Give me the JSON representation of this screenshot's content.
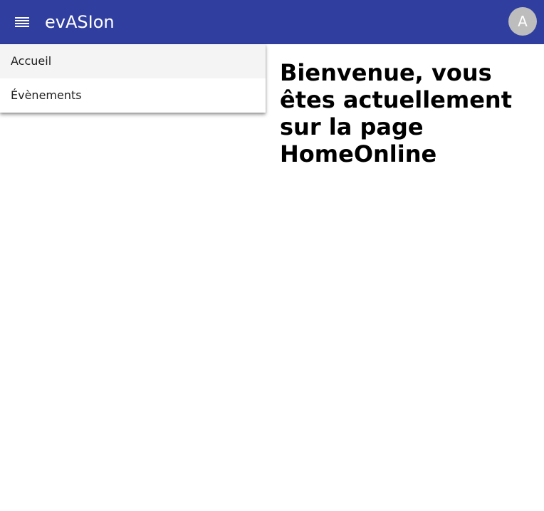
{
  "header": {
    "menu_icon": "hamburger-menu-icon",
    "title": "evASIon",
    "avatar_initial": "A"
  },
  "nav": {
    "items": [
      {
        "label": "Accueil",
        "active": true
      },
      {
        "label": "Évènements",
        "active": false
      }
    ]
  },
  "main": {
    "heading": "Bienvenue, vous êtes actuellement sur la page HomeOnline"
  },
  "colors": {
    "app_bar": "#303f9f",
    "avatar_bg": "#bdbdbd",
    "active_item_bg": "#f4f4f4"
  }
}
